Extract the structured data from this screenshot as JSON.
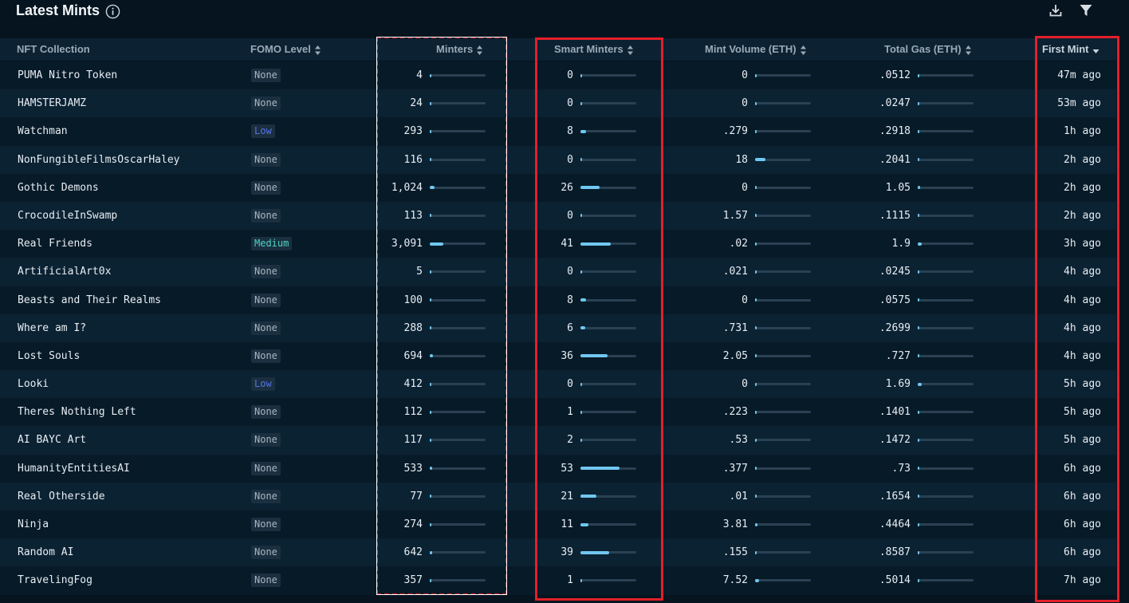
{
  "header": {
    "title": "Latest Mints",
    "info_icon": "info-icon",
    "download_icon": "download-icon",
    "filter_icon": "filter-icon"
  },
  "columns": {
    "collection": "NFT Collection",
    "fomo": "FOMO Level",
    "minters": "Minters",
    "smart_minters": "Smart Minters",
    "mint_volume": "Mint Volume (ETH)",
    "total_gas": "Total Gas (ETH)",
    "first_mint": "First Mint"
  },
  "sort": {
    "column": "first_mint",
    "direction": "descending"
  },
  "colors": {
    "background": "#06141f",
    "bar_fill": "#70c7f0",
    "highlight": "#e3202a",
    "fomo_low": "#5672e6",
    "fomo_medium": "#4fd3c6"
  },
  "scale_max": {
    "minters": 13000,
    "smart_minters": 75,
    "mint_volume": 100,
    "total_gas": 25
  },
  "rows": [
    {
      "collection": "PUMA Nitro Token",
      "fomo": "None",
      "minters": "4",
      "smart_minters": "0",
      "mint_volume": "0",
      "total_gas": ".0512",
      "first_mint": "47m ago"
    },
    {
      "collection": "HAMSTERJAMZ",
      "fomo": "None",
      "minters": "24",
      "smart_minters": "0",
      "mint_volume": "0",
      "total_gas": ".0247",
      "first_mint": "53m ago"
    },
    {
      "collection": "Watchman",
      "fomo": "Low",
      "minters": "293",
      "smart_minters": "8",
      "mint_volume": ".279",
      "total_gas": ".2918",
      "first_mint": "1h ago"
    },
    {
      "collection": "NonFungibleFilmsOscarHaley",
      "fomo": "None",
      "minters": "116",
      "smart_minters": "0",
      "mint_volume": "18",
      "total_gas": ".2041",
      "first_mint": "2h ago"
    },
    {
      "collection": "Gothic Demons",
      "fomo": "None",
      "minters": "1,024",
      "smart_minters": "26",
      "mint_volume": "0",
      "total_gas": "1.05",
      "first_mint": "2h ago"
    },
    {
      "collection": "CrocodileInSwamp",
      "fomo": "None",
      "minters": "113",
      "smart_minters": "0",
      "mint_volume": "1.57",
      "total_gas": ".1115",
      "first_mint": "2h ago"
    },
    {
      "collection": "Real Friends",
      "fomo": "Medium",
      "minters": "3,091",
      "smart_minters": "41",
      "mint_volume": ".02",
      "total_gas": "1.9",
      "first_mint": "3h ago"
    },
    {
      "collection": "ArtificialArt0x",
      "fomo": "None",
      "minters": "5",
      "smart_minters": "0",
      "mint_volume": ".021",
      "total_gas": ".0245",
      "first_mint": "4h ago"
    },
    {
      "collection": "Beasts and Their Realms",
      "fomo": "None",
      "minters": "100",
      "smart_minters": "8",
      "mint_volume": "0",
      "total_gas": ".0575",
      "first_mint": "4h ago"
    },
    {
      "collection": "Where am I?",
      "fomo": "None",
      "minters": "288",
      "smart_minters": "6",
      "mint_volume": ".731",
      "total_gas": ".2699",
      "first_mint": "4h ago"
    },
    {
      "collection": "Lost Souls",
      "fomo": "None",
      "minters": "694",
      "smart_minters": "36",
      "mint_volume": "2.05",
      "total_gas": ".727",
      "first_mint": "4h ago"
    },
    {
      "collection": "Looki",
      "fomo": "Low",
      "minters": "412",
      "smart_minters": "0",
      "mint_volume": "0",
      "total_gas": "1.69",
      "first_mint": "5h ago"
    },
    {
      "collection": "Theres Nothing Left",
      "fomo": "None",
      "minters": "112",
      "smart_minters": "1",
      "mint_volume": ".223",
      "total_gas": ".1401",
      "first_mint": "5h ago"
    },
    {
      "collection": "AI BAYC Art",
      "fomo": "None",
      "minters": "117",
      "smart_minters": "2",
      "mint_volume": ".53",
      "total_gas": ".1472",
      "first_mint": "5h ago"
    },
    {
      "collection": "HumanityEntitiesAI",
      "fomo": "None",
      "minters": "533",
      "smart_minters": "53",
      "mint_volume": ".377",
      "total_gas": ".73",
      "first_mint": "6h ago"
    },
    {
      "collection": "Real Otherside",
      "fomo": "None",
      "minters": "77",
      "smart_minters": "21",
      "mint_volume": ".01",
      "total_gas": ".1654",
      "first_mint": "6h ago"
    },
    {
      "collection": "Ninja",
      "fomo": "None",
      "minters": "274",
      "smart_minters": "11",
      "mint_volume": "3.81",
      "total_gas": ".4464",
      "first_mint": "6h ago"
    },
    {
      "collection": "Random AI",
      "fomo": "None",
      "minters": "642",
      "smart_minters": "39",
      "mint_volume": ".155",
      "total_gas": ".8587",
      "first_mint": "6h ago"
    },
    {
      "collection": "TravelingFog",
      "fomo": "None",
      "minters": "357",
      "smart_minters": "1",
      "mint_volume": "7.52",
      "total_gas": ".5014",
      "first_mint": "7h ago"
    }
  ]
}
